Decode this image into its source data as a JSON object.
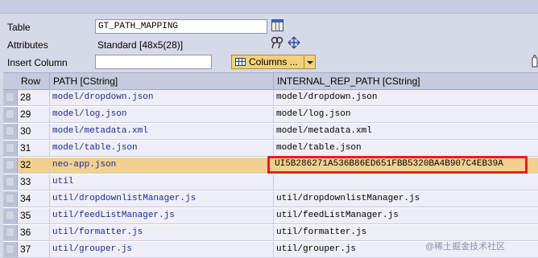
{
  "form": {
    "table_label": "Table",
    "table_value": "GT_PATH_MAPPING",
    "attributes_label": "Attributes",
    "attributes_value": "Standard [48x5(28)]",
    "insert_column_label": "Insert Column",
    "insert_column_value": "",
    "columns_button": "Columns ..."
  },
  "grid": {
    "headers": {
      "row": "Row",
      "path": "PATH [CString]",
      "internal": "INTERNAL_REP_PATH [CString]"
    },
    "rows": [
      {
        "row": "28",
        "path": "model/dropdown.json",
        "internal": "model/dropdown.json"
      },
      {
        "row": "29",
        "path": "model/log.json",
        "internal": "model/log.json"
      },
      {
        "row": "30",
        "path": "model/metadata.xml",
        "internal": "model/metadata.xml"
      },
      {
        "row": "31",
        "path": "model/table.json",
        "internal": "model/table.json"
      },
      {
        "row": "32",
        "path": "neo-app.json",
        "internal": "UI5B286271A536B86ED651FBB5320BA4B907C4EB39A",
        "selected": true
      },
      {
        "row": "33",
        "path": "util",
        "internal": ""
      },
      {
        "row": "34",
        "path": "util/dropdownlistManager.js",
        "internal": "util/dropdownlistManager.js"
      },
      {
        "row": "35",
        "path": "util/feedListManager.js",
        "internal": "util/feedListManager.js"
      },
      {
        "row": "36",
        "path": "util/formatter.js",
        "internal": "util/formatter.js"
      },
      {
        "row": "37",
        "path": "util/grouper.js",
        "internal": "util/grouper.js"
      }
    ]
  },
  "watermark": "@稀土掘金技术社区",
  "colors": {
    "highlight_border": "#e3201f",
    "selected_row": "#f2d190"
  }
}
